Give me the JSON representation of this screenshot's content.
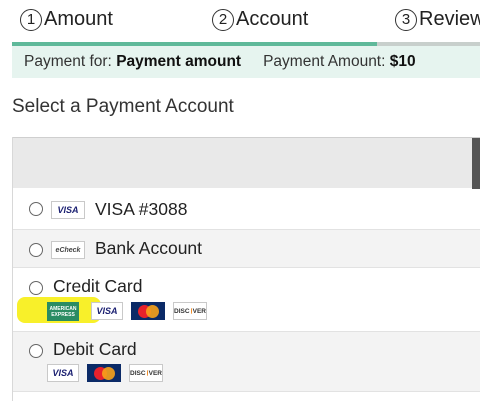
{
  "steps": [
    {
      "num": "1",
      "label": "Amount"
    },
    {
      "num": "2",
      "label": "Account"
    },
    {
      "num": "3",
      "label": "Review"
    }
  ],
  "progress": {
    "fraction": 0.78,
    "color": "#5fb99a"
  },
  "summary": {
    "for_label": "Payment for:",
    "for_value": "Payment amount",
    "amount_label": "Payment Amount:",
    "amount_value": "$10"
  },
  "section_title": "Select a Payment Account",
  "accounts": [
    {
      "label": "VISA #3088",
      "badges": [
        "VISA"
      ]
    },
    {
      "label": "Bank Account",
      "badges": [
        "eCheck"
      ]
    },
    {
      "label": "Credit Card",
      "badges": [
        "AMERICAN EXPRESS",
        "VISA",
        "MasterCard",
        "DISCOVER"
      ]
    },
    {
      "label": "Debit Card",
      "badges": [
        "VISA",
        "MasterCard",
        "DISCOVER"
      ]
    }
  ],
  "colors": {
    "summary_bg": "#e6f4ef",
    "highlight": "#f8f02a"
  }
}
